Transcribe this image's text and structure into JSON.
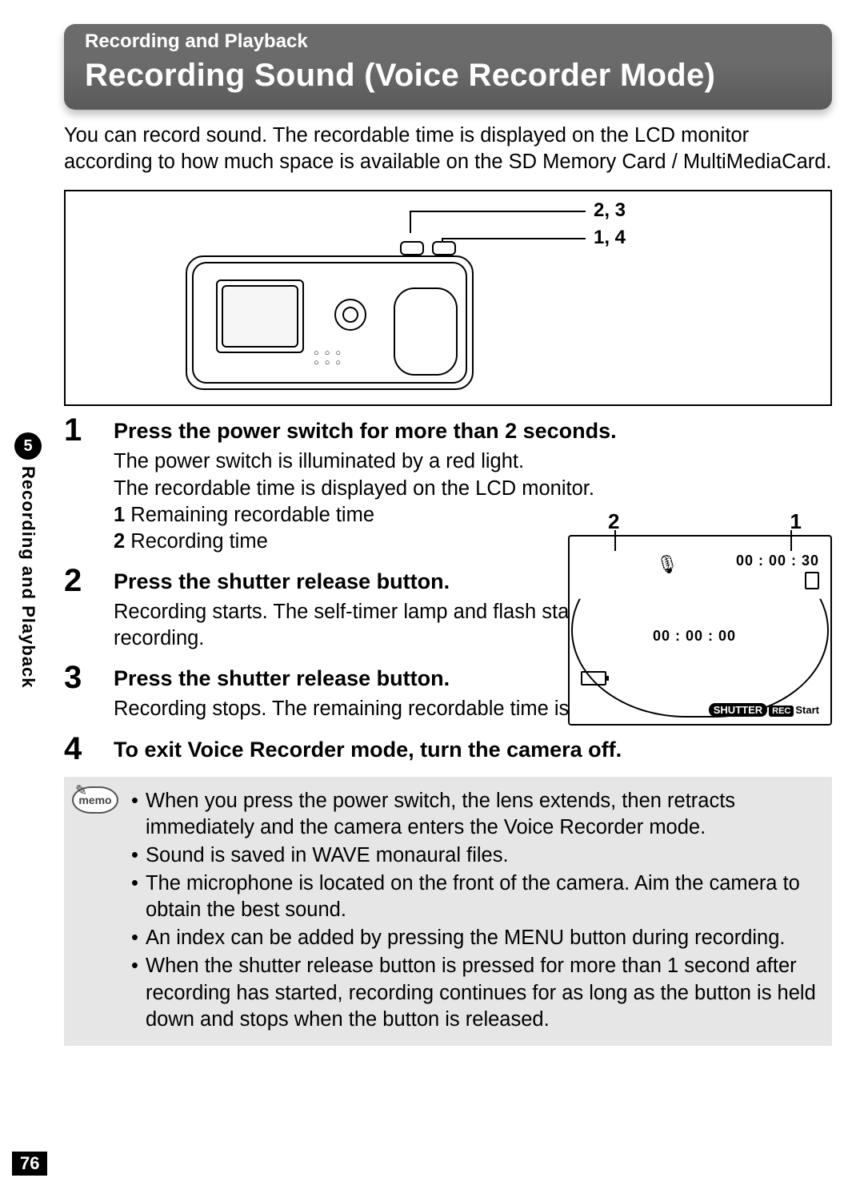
{
  "header": {
    "section": "Recording and Playback",
    "title": "Recording Sound (Voice Recorder Mode)"
  },
  "intro": "You can record sound. The recordable time is displayed on the LCD monitor according to how much space is available on the SD Memory Card / MultiMediaCard.",
  "diagram_callouts": {
    "top": "2, 3",
    "bottom": "1, 4"
  },
  "steps": [
    {
      "title": "Press the power switch for more than 2 seconds.",
      "body": "The power switch is illuminated by a red light.\nThe recordable time is displayed on the LCD monitor.",
      "sublist": [
        {
          "n": "1",
          "text": "Remaining recordable time"
        },
        {
          "n": "2",
          "text": "Recording time"
        }
      ]
    },
    {
      "title": "Press the shutter release button.",
      "body": "Recording starts. The self-timer lamp and flash status lamp light during recording."
    },
    {
      "title": "Press the shutter release button.",
      "body": "Recording stops. The remaining recordable time is displayed."
    },
    {
      "title": "To exit Voice Recorder mode, turn the camera off.",
      "body": ""
    }
  ],
  "lcd": {
    "callout_2": "2",
    "callout_1": "1",
    "time_remaining": "00 : 00 : 30",
    "time_recording": "00 : 00 : 00",
    "shutter_word": "SHUTTER",
    "rec_word": "REC",
    "start_word": "Start"
  },
  "memo_label": "memo",
  "memo": [
    "When you press the power switch, the lens extends, then retracts immediately and the camera enters the Voice Recorder mode.",
    "Sound is saved in WAVE monaural files.",
    "The microphone is located on the front of the camera. Aim the camera to obtain the best sound.",
    "An index can be added by pressing the MENU button during recording.",
    "When the shutter release button is pressed for more than 1 second after recording has started, recording continues for as long as the button is held down and stops when the button is released."
  ],
  "side": {
    "chapter": "5",
    "label": "Recording and Playback"
  },
  "page_number": "76"
}
